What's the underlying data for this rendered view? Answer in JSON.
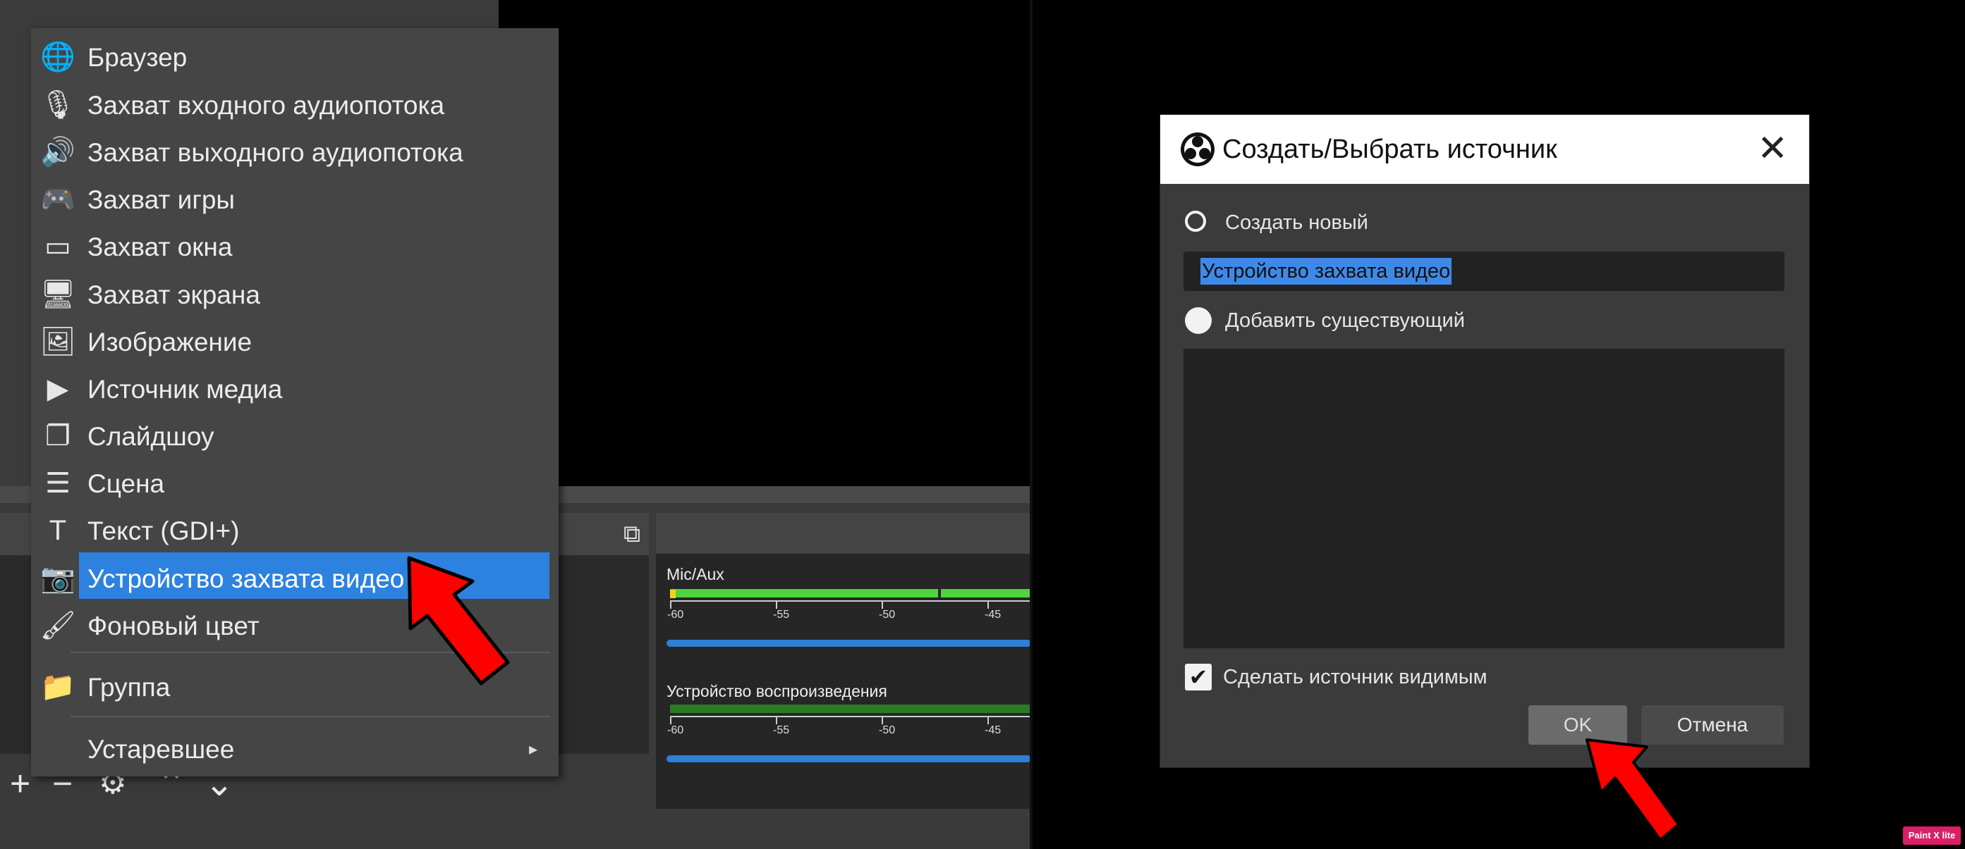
{
  "menu": {
    "items": [
      {
        "icon": "globe-icon",
        "glyph": "🌐",
        "label": "Браузер"
      },
      {
        "icon": "microphone-icon",
        "glyph": "🎙",
        "label": "Захват входного аудиопотока"
      },
      {
        "icon": "speaker-icon",
        "glyph": "🔊",
        "label": "Захват выходного аудиопотока"
      },
      {
        "icon": "gamepad-icon",
        "glyph": "🎮",
        "label": "Захват игры"
      },
      {
        "icon": "window-icon",
        "glyph": "▭",
        "label": "Захват окна"
      },
      {
        "icon": "monitor-icon",
        "glyph": "🖥",
        "label": "Захват экрана"
      },
      {
        "icon": "image-icon",
        "glyph": "🖼",
        "label": "Изображение"
      },
      {
        "icon": "play-icon",
        "glyph": "▶",
        "label": "Источник медиа"
      },
      {
        "icon": "slideshow-icon",
        "glyph": "❐",
        "label": "Слайдшоу"
      },
      {
        "icon": "list-icon",
        "glyph": "☰",
        "label": "Сцена"
      },
      {
        "icon": "text-icon",
        "glyph": "T",
        "label": "Текст (GDI+)"
      },
      {
        "icon": "camera-icon",
        "glyph": "📷",
        "label": "Устройство захвата видео",
        "selected": true
      },
      {
        "icon": "brush-icon",
        "glyph": "🖌",
        "label": "Фоновый цвет"
      }
    ],
    "group": {
      "icon": "folder-icon",
      "glyph": "📁",
      "label": "Группа"
    },
    "deprecated": {
      "label": "Устаревшее",
      "arrow": "▸"
    }
  },
  "toolbar": {
    "add": "+",
    "remove": "−",
    "settings": "⚙",
    "up": "⌃",
    "down": "⌄"
  },
  "mixer": {
    "channels": [
      {
        "name": "Mic/Aux"
      },
      {
        "name": "Устройство воспроизведения"
      }
    ],
    "ticks": [
      "-60",
      "-55",
      "-50",
      "-45"
    ]
  },
  "dialog": {
    "title": "Создать/Выбрать источник",
    "close": "✕",
    "create_new_label": "Создать новый",
    "new_name_value": "Устройство захвата видео",
    "add_existing_label": "Добавить существующий",
    "make_visible_label": "Сделать источник видимым",
    "make_visible_checked": "✔",
    "ok_label": "OK",
    "cancel_label": "Отмена"
  },
  "watermark": "Paint X lite",
  "colors": {
    "accent": "#2d82df",
    "arrow": "#ff0000",
    "meter_green": "#4fd33f"
  }
}
